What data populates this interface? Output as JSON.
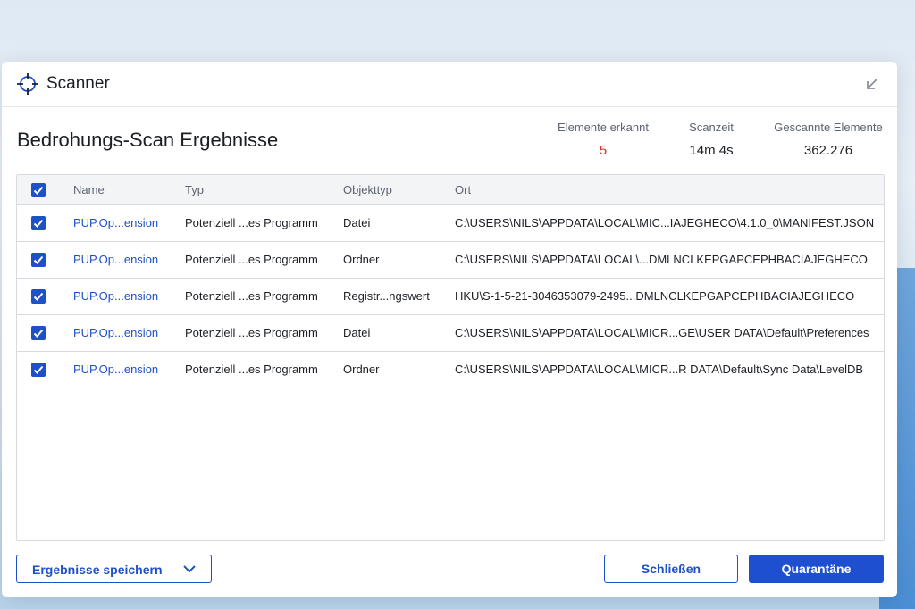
{
  "window": {
    "title": "Scanner",
    "icon": "crosshair-icon",
    "collapse_icon": "collapse-arrow-icon"
  },
  "page_title": "Bedrohungs-Scan Ergebnisse",
  "stats": {
    "detected_label": "Elemente erkannt",
    "detected_value": "5",
    "time_label": "Scanzeit",
    "time_value": "14m 4s",
    "scanned_label": "Gescannte Elemente",
    "scanned_value": "362.276"
  },
  "colors": {
    "accent": "#1e50c8",
    "alert": "#d9302c"
  },
  "table": {
    "columns": [
      "Name",
      "Typ",
      "Objekttyp",
      "Ort"
    ],
    "rows": [
      {
        "name": "PUP.Op...ension",
        "type": "Potenziell ...es Programm",
        "object": "Datei",
        "path": "C:\\USERS\\NILS\\APPDATA\\LOCAL\\MIC...IAJEGHECO\\4.1.0_0\\MANIFEST.JSON",
        "checked": true
      },
      {
        "name": "PUP.Op...ension",
        "type": "Potenziell ...es Programm",
        "object": "Ordner",
        "path": "C:\\USERS\\NILS\\APPDATA\\LOCAL\\...DMLNCLKEPGAPCEPHBACIAJEGHECO",
        "checked": true
      },
      {
        "name": "PUP.Op...ension",
        "type": "Potenziell ...es Programm",
        "object": "Registr...ngswert",
        "path": "HKU\\S-1-5-21-3046353079-2495...DMLNCLKEPGAPCEPHBACIAJEGHECO",
        "checked": true
      },
      {
        "name": "PUP.Op...ension",
        "type": "Potenziell ...es Programm",
        "object": "Datei",
        "path": "C:\\USERS\\NILS\\APPDATA\\LOCAL\\MICR...GE\\USER DATA\\Default\\Preferences",
        "checked": true
      },
      {
        "name": "PUP.Op...ension",
        "type": "Potenziell ...es Programm",
        "object": "Ordner",
        "path": "C:\\USERS\\NILS\\APPDATA\\LOCAL\\MICR...R DATA\\Default\\Sync Data\\LevelDB",
        "checked": true
      }
    ]
  },
  "footer": {
    "save_label": "Ergebnisse speichern",
    "close_label": "Schließen",
    "quarantine_label": "Quarantäne"
  }
}
